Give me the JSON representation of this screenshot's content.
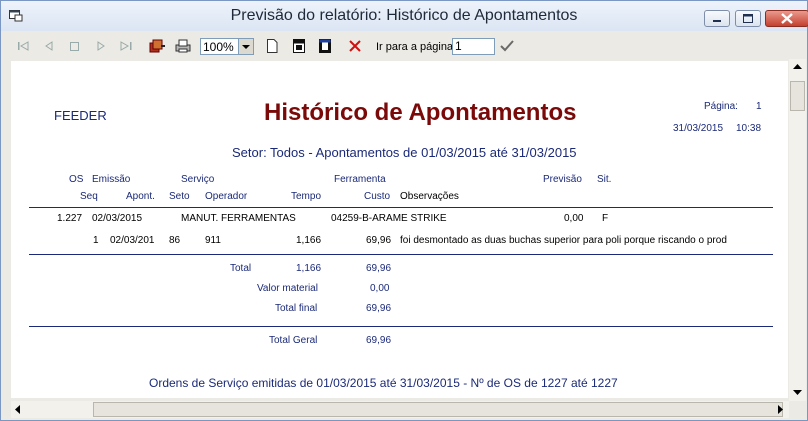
{
  "window": {
    "title": "Previsão do relatório: Histórico de Apontamentos"
  },
  "toolbar": {
    "zoom_value": "100%",
    "goto_label": "Ir para a página",
    "goto_value": "1"
  },
  "report": {
    "company": "FEEDER",
    "title": "Histórico de Apontamentos",
    "page_label": "Página:",
    "page_number": "1",
    "date": "31/03/2015",
    "time": "10:38",
    "subtitle": "Setor: Todos - Apontamentos de 01/03/2015 até 31/03/2015",
    "headers": {
      "os": "OS",
      "emissao": "Emissão",
      "servico": "Serviço",
      "ferramenta": "Ferramenta",
      "previsao": "Previsão",
      "sit": "Sit.",
      "seq": "Seq",
      "apont": "Apont.",
      "seto": "Seto",
      "operador": "Operador",
      "tempo": "Tempo",
      "custo": "Custo",
      "observacoes": "Observações"
    },
    "order": {
      "os": "1.227",
      "emissao": "02/03/2015",
      "servico": "MANUT. FERRAMENTAS",
      "ferramenta": "04259-B-ARAME STRIKE",
      "previsao": "0,00",
      "sit": "F"
    },
    "entry": {
      "seq": "1",
      "apont": "02/03/201",
      "seto": "86",
      "operador": "911",
      "tempo": "1,166",
      "custo": "69,96",
      "obs": "foi desmontado as duas buchas superior para poli porque riscando o prod"
    },
    "totals": {
      "total_label": "Total",
      "total_tempo": "1,166",
      "total_custo": "69,96",
      "material_label": "Valor material",
      "material_value": "0,00",
      "final_label": "Total final",
      "final_value": "69,96",
      "geral_label": "Total Geral",
      "geral_value": "69,96"
    },
    "footer": "Ordens de Serviço emitidas de 01/03/2015 até 31/03/2015 - Nº de OS de 1227 até 1227"
  }
}
